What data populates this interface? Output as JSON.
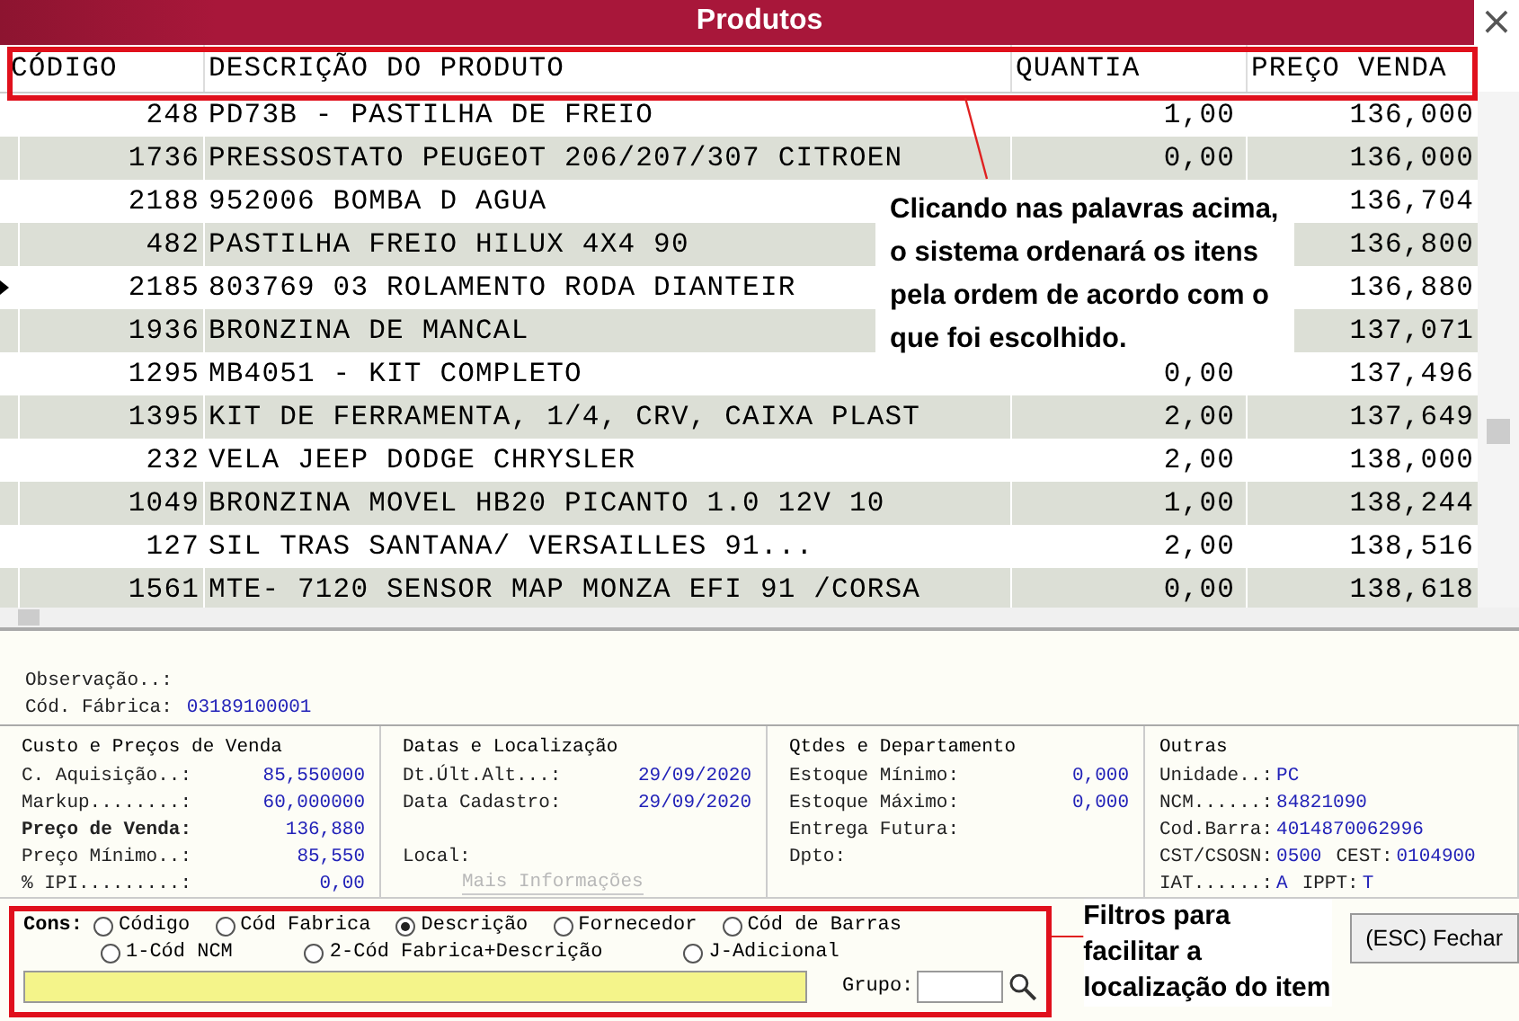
{
  "window": {
    "title": "Produtos",
    "close": "×"
  },
  "grid": {
    "columns": [
      "CÓDIGO",
      "DESCRIÇÃO DO PRODUTO",
      "QUANTIA",
      "PREÇO VENDA"
    ],
    "rows": [
      {
        "code": "248",
        "description": "PD73B - PASTILHA DE FREIO",
        "quantity": "1,00",
        "price": "136,000",
        "current": false
      },
      {
        "code": "1736",
        "description": "PRESSOSTATO PEUGEOT 206/207/307 CITROEN",
        "quantity": "0,00",
        "price": "136,000",
        "current": false
      },
      {
        "code": "2188",
        "description": "952006 BOMBA D AGUA",
        "price": "136,704",
        "current": false
      },
      {
        "code": "482",
        "description": "PASTILHA FREIO HILUX 4X4 90",
        "price": "136,800",
        "current": false
      },
      {
        "code": "2185",
        "description": "803769 03 ROLAMENTO RODA DIANTEIR",
        "price": "136,880",
        "current": true
      },
      {
        "code": "1936",
        "description": "BRONZINA DE MANCAL",
        "price": "137,071",
        "current": false
      },
      {
        "code": "1295",
        "description": "MB4051 - KIT COMPLETO",
        "quantity": "0,00",
        "price": "137,496",
        "current": false
      },
      {
        "code": "1395",
        "description": "KIT DE FERRAMENTA, 1/4, CRV, CAIXA PLAST",
        "quantity": "2,00",
        "price": "137,649",
        "current": false
      },
      {
        "code": "232",
        "description": "VELA JEEP DODGE CHRYSLER",
        "quantity": "2,00",
        "price": "138,000",
        "current": false
      },
      {
        "code": "1049",
        "description": "BRONZINA MOVEL HB20 PICANTO 1.0 12V 10",
        "quantity": "1,00",
        "price": "138,244",
        "current": false
      },
      {
        "code": "127",
        "description": "SIL TRAS SANTANA/ VERSAILLES 91...",
        "quantity": "2,00",
        "price": "138,516",
        "current": false
      },
      {
        "code": "1561",
        "description": "MTE- 7120 SENSOR MAP MONZA EFI 91 /CORSA",
        "quantity": "0,00",
        "price": "138,618",
        "current": false
      }
    ]
  },
  "observation": {
    "fields": [
      {
        "label": "Observação..:"
      },
      {
        "label": "Cód. Fábrica:",
        "value": "03189100001"
      }
    ]
  },
  "groups": [
    {
      "title": "Custo e Preços de Venda",
      "kind": "aligned",
      "rows": [
        [
          {
            "label": "C. Aquisição..:",
            "value": "85,550000"
          }
        ],
        [
          {
            "label": "Markup........:",
            "value": "60,000000"
          }
        ],
        [
          {
            "label": "Preço de Venda:",
            "value": "136,880",
            "bold": true
          }
        ],
        [
          {
            "label": "Preço Mínimo..:",
            "value": "85,550"
          }
        ],
        [
          {
            "label": "% IPI.........:",
            "value": "0,00"
          }
        ]
      ]
    },
    {
      "title": "Datas e Localização",
      "kind": "aligned",
      "rows": [
        [
          {
            "label": "Dt.Últ.Alt...:",
            "value": "29/09/2020"
          }
        ],
        [
          {
            "label": "Data Cadastro:",
            "value": "29/09/2020"
          }
        ],
        [],
        [
          {
            "label": "Local:"
          }
        ]
      ],
      "link": {
        "label": "Mais Informações",
        "disabled": true
      }
    },
    {
      "title": "Qtdes e Departamento",
      "kind": "aligned",
      "rows": [
        [
          {
            "label": "Estoque Mínimo:",
            "value": "0,000"
          }
        ],
        [
          {
            "label": "Estoque Máximo:",
            "value": "0,000"
          }
        ],
        [
          {
            "label": "Entrega Futura:"
          }
        ],
        [
          {
            "label": "Dpto:"
          }
        ]
      ]
    },
    {
      "title": "Outras",
      "kind": "inline",
      "rows": [
        [
          {
            "label": "Unidade..:",
            "value": "PC"
          }
        ],
        [
          {
            "label": "NCM......:",
            "value": "84821090"
          }
        ],
        [
          {
            "label": "Cod.Barra:",
            "value": "4014870062996"
          }
        ],
        [
          {
            "label": "CST/CSOSN:",
            "value": "0500"
          },
          {
            "label": "CEST:",
            "value": "0104900"
          }
        ],
        [
          {
            "label": "IAT......:",
            "value": "A"
          },
          {
            "label": "IPPT:",
            "value": "T"
          }
        ]
      ]
    }
  ],
  "filters": {
    "label": "Cons:",
    "options": [
      {
        "label": "Código",
        "selected": false
      },
      {
        "label": "Cód Fabrica",
        "selected": false
      },
      {
        "label": "Descrição",
        "selected": true
      },
      {
        "label": "Fornecedor",
        "selected": false
      },
      {
        "label": "Cód de Barras",
        "selected": false
      },
      {
        "label": "1-Cód NCM",
        "selected": false
      },
      {
        "label": "2-Cód Fabrica+Descrição",
        "selected": false
      },
      {
        "label": "J-Adicional",
        "selected": false
      }
    ],
    "group_label": "Grupo:"
  },
  "close_button": "(ESC) Fechar",
  "annotations": [
    {
      "kind": "sort",
      "text": "Clicando nas palavras acima, o sistema ordenará os itens pela ordem de acordo com o que foi escolhido."
    },
    {
      "kind": "filter",
      "text": "Filtros para facilitar a localização do item"
    }
  ]
}
